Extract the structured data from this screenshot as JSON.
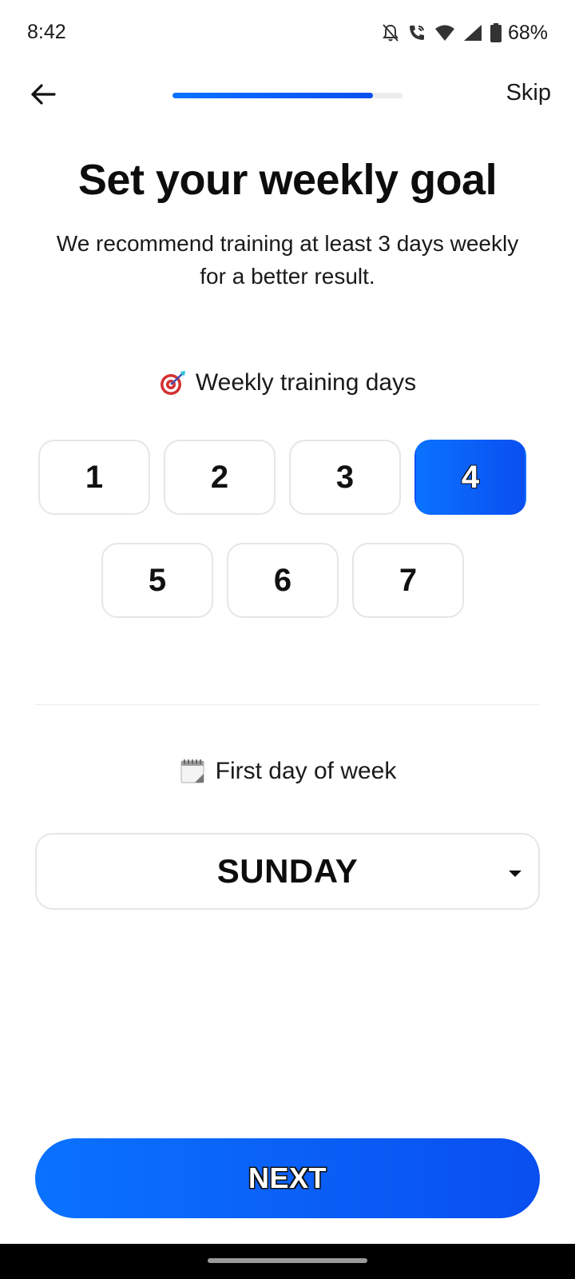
{
  "status_bar": {
    "time": "8:42",
    "battery": "68%",
    "icons": [
      "bell-off-icon",
      "wifi-calling-icon",
      "wifi-icon",
      "signal-icon",
      "battery-icon"
    ]
  },
  "top_bar": {
    "back_icon": "arrow-left-icon",
    "progress": 0.87,
    "skip_label": "Skip"
  },
  "header": {
    "title": "Set your weekly goal",
    "subtitle": "We recommend training at least 3 days weekly for a better result."
  },
  "training_days": {
    "label": "Weekly training days",
    "icon": "target-icon",
    "options": [
      "1",
      "2",
      "3",
      "4",
      "5",
      "6",
      "7"
    ],
    "selected": "4"
  },
  "first_day": {
    "label": "First day of week",
    "icon": "calendar-icon",
    "value": "SUNDAY"
  },
  "footer": {
    "next_label": "NEXT"
  },
  "colors": {
    "accent_start": "#0a72ff",
    "accent_end": "#0a4ff0",
    "border": "#e6e6e6"
  }
}
